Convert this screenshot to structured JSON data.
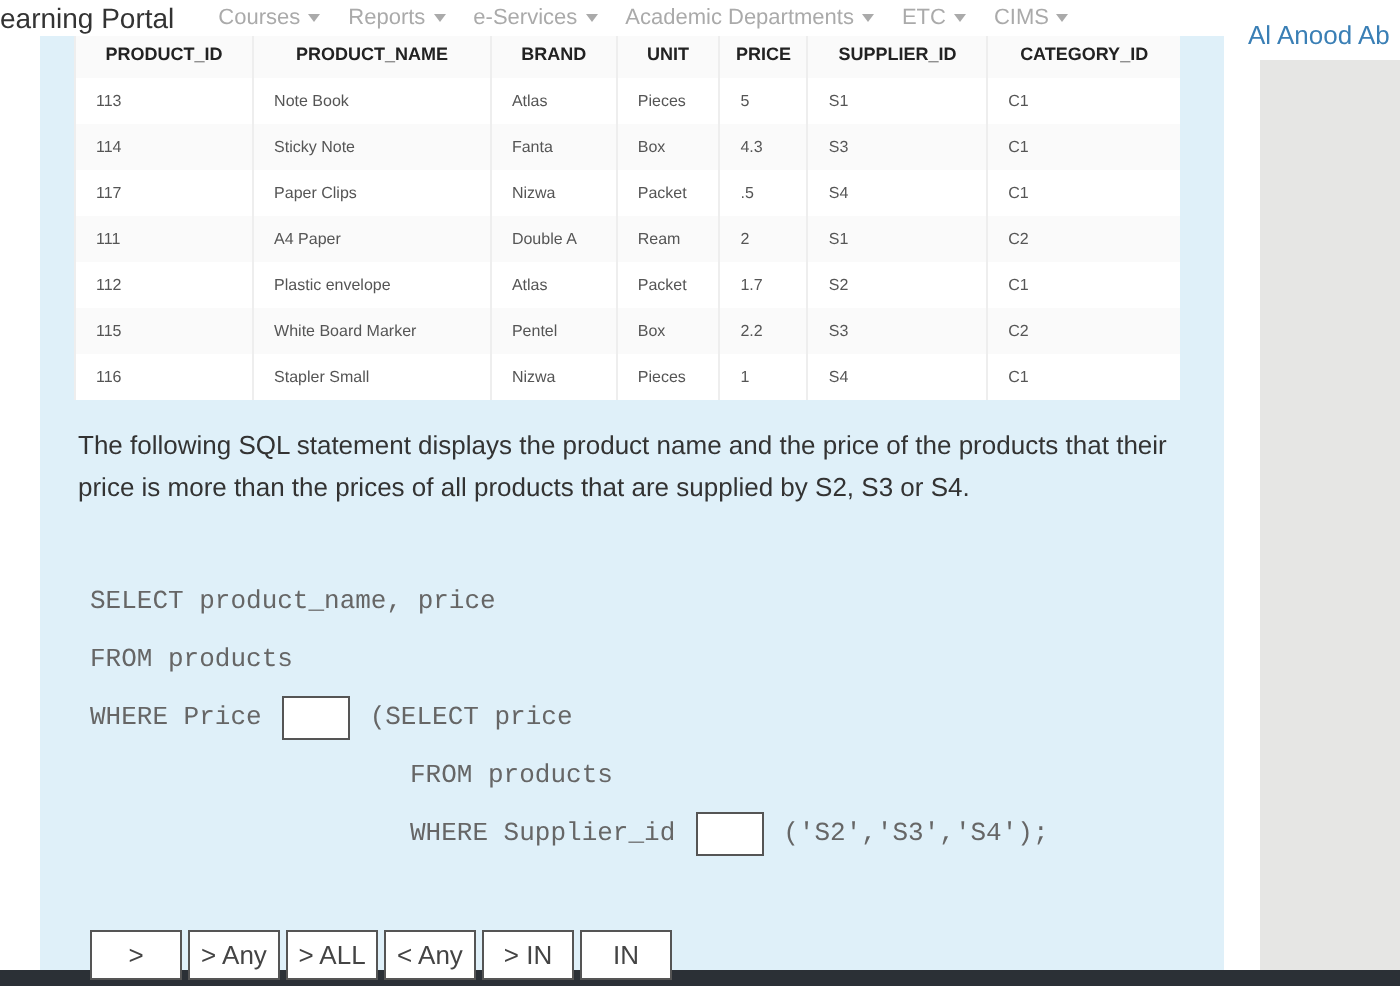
{
  "nav": {
    "brand": "earning Portal",
    "items": [
      {
        "label": "Courses"
      },
      {
        "label": "Reports"
      },
      {
        "label": "e-Services"
      },
      {
        "label": "Academic Departments"
      },
      {
        "label": "ETC"
      },
      {
        "label": "CIMS"
      }
    ],
    "user": "Al Anood Ab"
  },
  "table": {
    "columns": [
      "PRODUCT_ID",
      "PRODUCT_NAME",
      "BRAND",
      "UNIT",
      "PRICE",
      "SUPPLIER_ID",
      "CATEGORY_ID"
    ],
    "rows": [
      [
        "113",
        "Note Book",
        "Atlas",
        "Pieces",
        "5",
        "S1",
        "C1"
      ],
      [
        "114",
        "Sticky Note",
        "Fanta",
        "Box",
        "4.3",
        "S3",
        "C1"
      ],
      [
        "117",
        "Paper Clips",
        "Nizwa",
        "Packet",
        ".5",
        "S4",
        "C1"
      ],
      [
        "111",
        "A4 Paper",
        "Double A",
        "Ream",
        "2",
        "S1",
        "C2"
      ],
      [
        "112",
        "Plastic envelope",
        "Atlas",
        "Packet",
        "1.7",
        "S2",
        "C1"
      ],
      [
        "115",
        "White Board Marker",
        "Pentel",
        "Box",
        "2.2",
        "S3",
        "C2"
      ],
      [
        "116",
        "Stapler Small",
        "Nizwa",
        "Pieces",
        "1",
        "S4",
        "C1"
      ]
    ]
  },
  "question": "The following SQL statement displays the product name and the price of the products that their price is more than the prices of all products that are supplied by S2, S3 or S4.",
  "sql_lines": [
    {
      "parts": [
        {
          "kind": "code",
          "text": "SELECT product_name, price"
        }
      ]
    },
    {
      "parts": [
        {
          "kind": "code",
          "text": "FROM products"
        }
      ]
    },
    {
      "parts": [
        {
          "kind": "code",
          "text": "WHERE Price"
        },
        {
          "kind": "blank"
        },
        {
          "kind": "code",
          "text": "(SELECT price"
        }
      ],
      "children": [
        {
          "parts": [
            {
              "kind": "code",
              "text": "FROM products"
            }
          ]
        },
        {
          "parts": [
            {
              "kind": "code",
              "text": "WHERE Supplier_id"
            },
            {
              "kind": "blank"
            },
            {
              "kind": "code",
              "text": "('S2','S3','S4');"
            }
          ]
        }
      ]
    }
  ],
  "options": [
    ">",
    "> Any",
    "> ALL",
    "< Any",
    "> IN",
    "IN"
  ]
}
